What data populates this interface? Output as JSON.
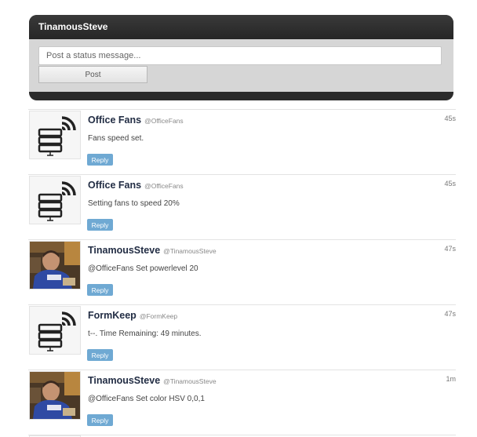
{
  "panel": {
    "username": "TinamousSteve",
    "status_placeholder": "Post a status message...",
    "post_label": "Post"
  },
  "feed": [
    {
      "name": "Office Fans",
      "handle": "@OfficeFans",
      "time": "45s",
      "message": "Fans speed set.",
      "reply_label": "Reply",
      "avatar": "device-icon"
    },
    {
      "name": "Office Fans",
      "handle": "@OfficeFans",
      "time": "45s",
      "message": "Setting fans to speed 20%",
      "reply_label": "Reply",
      "avatar": "device-icon"
    },
    {
      "name": "TinamousSteve",
      "handle": "@TinamousSteve",
      "time": "47s",
      "message": "@OfficeFans Set powerlevel 20",
      "reply_label": "Reply",
      "avatar": "user-photo"
    },
    {
      "name": "FormKeep",
      "handle": "@FormKeep",
      "time": "47s",
      "message": "t--. Time Remaining: 49 minutes.",
      "reply_label": "Reply",
      "avatar": "device-icon"
    },
    {
      "name": "TinamousSteve",
      "handle": "@TinamousSteve",
      "time": "1m",
      "message": "@OfficeFans Set color HSV 0,0,1",
      "reply_label": "Reply",
      "avatar": "user-photo"
    }
  ]
}
